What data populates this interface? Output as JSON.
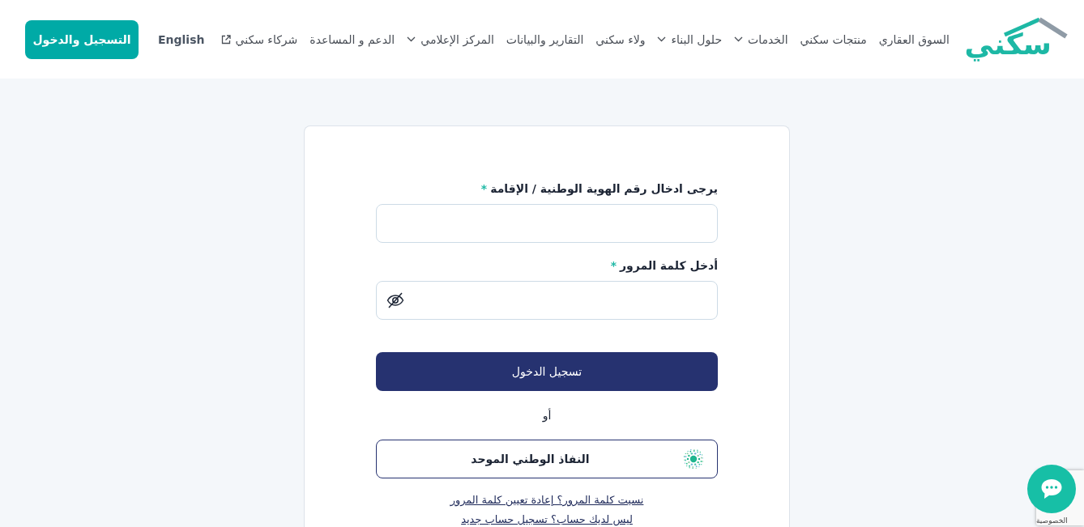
{
  "header": {
    "logo": "سكني",
    "nav": [
      {
        "label": "السوق العقاري",
        "kind": "link"
      },
      {
        "label": "منتجات سكني",
        "kind": "link"
      },
      {
        "label": "الخدمات",
        "kind": "dropdown"
      },
      {
        "label": "حلول البناء",
        "kind": "dropdown"
      },
      {
        "label": "ولاء سكني",
        "kind": "link"
      },
      {
        "label": "التقارير والبيانات",
        "kind": "link"
      },
      {
        "label": "المركز الإعلامي",
        "kind": "dropdown"
      },
      {
        "label": "الدعم و المساعدة",
        "kind": "link"
      },
      {
        "label": "شركاء سكني",
        "kind": "external"
      }
    ],
    "language": "English",
    "login_button": "التسجيل والدخول"
  },
  "form": {
    "fields": [
      {
        "label": "يرجى ادخال رقم الهوية الوطنية / الإقامة",
        "required_mark": "*",
        "kind": "text"
      },
      {
        "label": "أدخل كلمة المرور",
        "required_mark": "*",
        "kind": "password"
      }
    ],
    "submit": "تسجيل الدخول",
    "separator": "أو",
    "nafath_button": "النفاذ الوطني الموحد",
    "links": [
      "نسيت كلمة المرور؟ إعادة تعيين كلمة المرور",
      "ليس لديك حساب؟ تسجيل حساب جديد"
    ]
  },
  "recaptcha_badge": {
    "text": "الخصوصية"
  }
}
